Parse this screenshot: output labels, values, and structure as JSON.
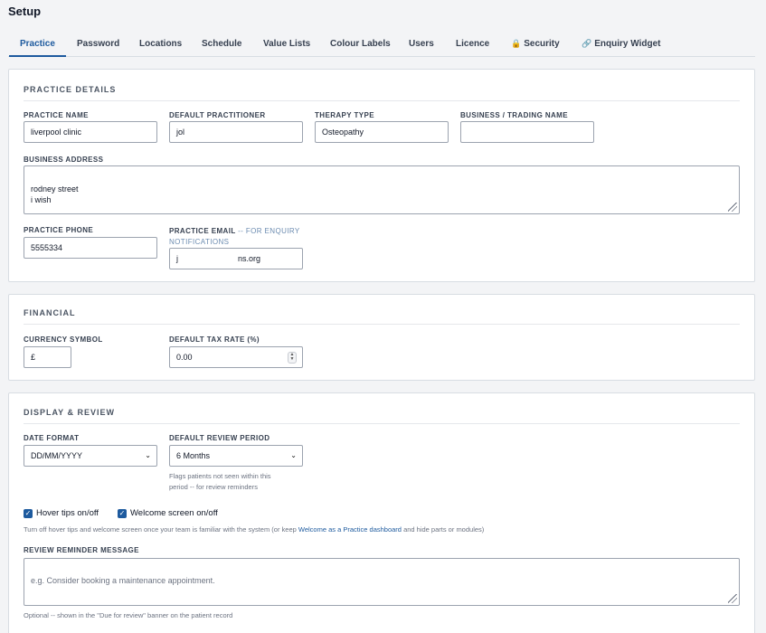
{
  "page": {
    "title": "Setup"
  },
  "tabs": [
    {
      "label": "Practice",
      "active": true
    },
    {
      "label": "Password"
    },
    {
      "label": "Locations"
    },
    {
      "label": "Schedule"
    },
    {
      "label": "Value Lists"
    },
    {
      "label": "Colour Labels"
    },
    {
      "label": "Users"
    },
    {
      "label": "Licence"
    },
    {
      "label": "Security",
      "icon": "lock-icon",
      "glyph": "🔒"
    },
    {
      "label": "Enquiry Widget",
      "icon": "link-icon",
      "glyph": "🔗"
    }
  ],
  "practice_details": {
    "heading": "PRACTICE DETAILS",
    "practice_name": {
      "label": "PRACTICE NAME",
      "value": "liverpool clinic"
    },
    "default_practitioner": {
      "label": "DEFAULT PRACTITIONER",
      "value": "jol"
    },
    "therapy_type": {
      "label": "THERAPY TYPE",
      "value": "Osteopathy"
    },
    "business_name": {
      "label": "BUSINESS / TRADING NAME",
      "value": ""
    },
    "business_address": {
      "label": "BUSINESS ADDRESS",
      "value": "rodney street\ni wish"
    },
    "practice_phone": {
      "label": "PRACTICE PHONE",
      "value": "5555334"
    },
    "practice_email": {
      "label": "PRACTICE EMAIL",
      "note_line1": "-- FOR ENQUIRY",
      "note_line2": "NOTIFICATIONS",
      "value_start": "j",
      "value_end": "ns.org"
    }
  },
  "financial": {
    "heading": "FINANCIAL",
    "currency_symbol": {
      "label": "CURRENCY SYMBOL",
      "value": "£"
    },
    "tax_rate": {
      "label": "DEFAULT TAX RATE (%)",
      "value": "0.00"
    }
  },
  "display_review": {
    "heading": "DISPLAY & REVIEW",
    "date_format": {
      "label": "DATE FORMAT",
      "value": "DD/MM/YYYY"
    },
    "review_period": {
      "label": "DEFAULT REVIEW PERIOD",
      "value": "6 Months",
      "hint_line1": "Flags patients not seen within this",
      "hint_line2": "period -- for review reminders"
    },
    "hover_tips": {
      "label": "Hover tips on/off",
      "checked": true
    },
    "welcome_screen": {
      "label": "Welcome screen on/off",
      "checked": true
    },
    "toggle_hint_before": "Turn off hover tips and welcome screen once your team is familiar with the system (or keep ",
    "toggle_hint_link": "Welcome as a Practice dashboard",
    "toggle_hint_after": " and hide parts or modules)",
    "reminder_message": {
      "label": "REVIEW REMINDER MESSAGE",
      "placeholder": "e.g. Consider booking a maintenance appointment."
    },
    "reminder_hint": "Optional -- shown in the \"Due for review\" banner on the patient record"
  },
  "colors": {
    "accent": "#1d5a9e",
    "border": "#d8dde3",
    "background": "#f3f4f6"
  }
}
